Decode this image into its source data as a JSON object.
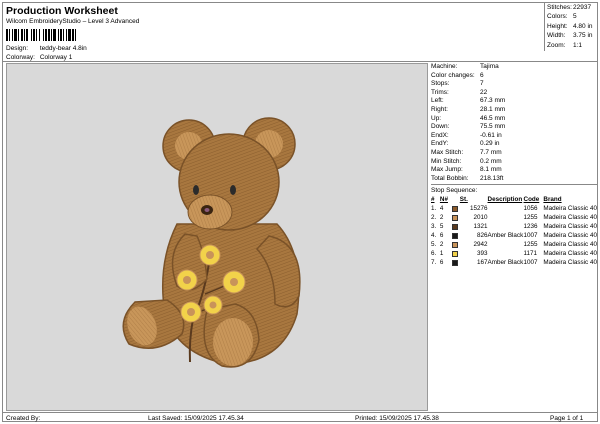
{
  "header": {
    "title": "Production Worksheet",
    "subtitle": "Wilcom EmbroideryStudio – Level 3 Advanced",
    "design_label": "Design:",
    "design_value": "teddy-bear 4.8in",
    "colorway_label": "Colorway:",
    "colorway_value": "Colorway 1"
  },
  "stats": [
    {
      "label": "Stitches:",
      "value": "22937"
    },
    {
      "label": "Colors:",
      "value": "5"
    },
    {
      "label": "Height:",
      "value": "4.80 in"
    },
    {
      "label": "Width:",
      "value": "3.75 in"
    },
    {
      "label": "Zoom:",
      "value": "1:1"
    }
  ],
  "info": [
    {
      "label": "Machine:",
      "value": "Tajima"
    },
    {
      "label": "Color changes:",
      "value": "6"
    },
    {
      "label": "Stops:",
      "value": "7"
    },
    {
      "label": "Trims:",
      "value": "22"
    },
    {
      "label": "Left:",
      "value": "67.3 mm"
    },
    {
      "label": "Right:",
      "value": "28.1 mm"
    },
    {
      "label": "Up:",
      "value": "46.5 mm"
    },
    {
      "label": "Down:",
      "value": "75.5 mm"
    },
    {
      "label": "EndX:",
      "value": "-0.61 in"
    },
    {
      "label": "EndY:",
      "value": "0.29 in"
    },
    {
      "label": "Max Stitch:",
      "value": "7.7 mm"
    },
    {
      "label": "Min Stitch:",
      "value": "0.2 mm"
    },
    {
      "label": "Max Jump:",
      "value": "8.1 mm"
    },
    {
      "label": "Total Bobbin:",
      "value": "218.13ft"
    }
  ],
  "stop_sequence": {
    "title": "Stop Sequence:",
    "headers": [
      "#",
      "N#",
      "",
      "St.",
      "Description",
      "Code",
      "Brand"
    ],
    "rows": [
      {
        "idx": "1.",
        "n": "4",
        "color": "#8b5a2b",
        "st": "15276",
        "desc": "",
        "code": "1056",
        "brand": "Madeira Classic 40"
      },
      {
        "idx": "2.",
        "n": "2",
        "color": "#c8935a",
        "st": "2010",
        "desc": "",
        "code": "1255",
        "brand": "Madeira Classic 40"
      },
      {
        "idx": "3.",
        "n": "5",
        "color": "#5a3a1e",
        "st": "1321",
        "desc": "",
        "code": "1236",
        "brand": "Madeira Classic 40"
      },
      {
        "idx": "4.",
        "n": "6",
        "color": "#1a1a1a",
        "st": "826",
        "desc": "Amber Black",
        "code": "1007",
        "brand": "Madeira Classic 40"
      },
      {
        "idx": "5.",
        "n": "2",
        "color": "#c8935a",
        "st": "2942",
        "desc": "",
        "code": "1255",
        "brand": "Madeira Classic 40"
      },
      {
        "idx": "6.",
        "n": "1",
        "color": "#f2d24a",
        "st": "393",
        "desc": "",
        "code": "1171",
        "brand": "Madeira Classic 40"
      },
      {
        "idx": "7.",
        "n": "6",
        "color": "#1a1a1a",
        "st": "167",
        "desc": "Amber Black",
        "code": "1007",
        "brand": "Madeira Classic 40"
      }
    ]
  },
  "footer": {
    "created_by": "Created By:",
    "last_saved": "Last Saved: 15/09/2025 17.45.34",
    "printed": "Printed: 15/09/2025 17.45.38",
    "page": "Page 1 of 1"
  },
  "preview": {
    "background": "#d9d9d9",
    "fur_color": "#a8773f",
    "fur_light": "#c8965a",
    "fur_dark": "#7a5228",
    "flower_color": "#f2d24a",
    "flower_center": "#c8935a",
    "stem_color": "#5a3a1e"
  }
}
